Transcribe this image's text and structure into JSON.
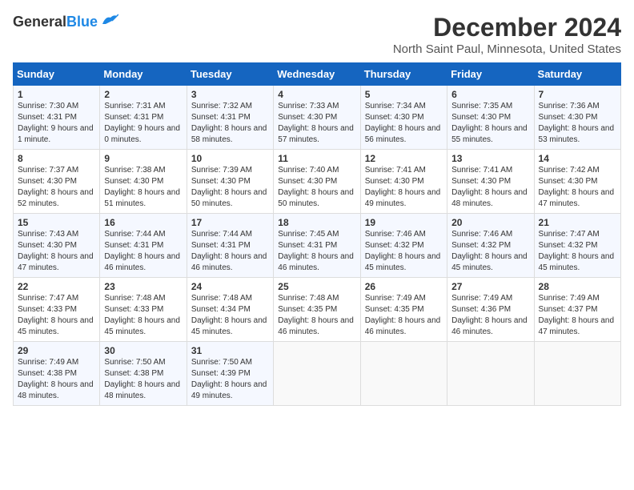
{
  "header": {
    "logo_line1": "General",
    "logo_line2": "Blue",
    "month": "December 2024",
    "location": "North Saint Paul, Minnesota, United States"
  },
  "days_of_week": [
    "Sunday",
    "Monday",
    "Tuesday",
    "Wednesday",
    "Thursday",
    "Friday",
    "Saturday"
  ],
  "weeks": [
    [
      {
        "day": "1",
        "sunrise": "7:30 AM",
        "sunset": "4:31 PM",
        "daylight": "9 hours and 1 minute."
      },
      {
        "day": "2",
        "sunrise": "7:31 AM",
        "sunset": "4:31 PM",
        "daylight": "9 hours and 0 minutes."
      },
      {
        "day": "3",
        "sunrise": "7:32 AM",
        "sunset": "4:31 PM",
        "daylight": "8 hours and 58 minutes."
      },
      {
        "day": "4",
        "sunrise": "7:33 AM",
        "sunset": "4:30 PM",
        "daylight": "8 hours and 57 minutes."
      },
      {
        "day": "5",
        "sunrise": "7:34 AM",
        "sunset": "4:30 PM",
        "daylight": "8 hours and 56 minutes."
      },
      {
        "day": "6",
        "sunrise": "7:35 AM",
        "sunset": "4:30 PM",
        "daylight": "8 hours and 55 minutes."
      },
      {
        "day": "7",
        "sunrise": "7:36 AM",
        "sunset": "4:30 PM",
        "daylight": "8 hours and 53 minutes."
      }
    ],
    [
      {
        "day": "8",
        "sunrise": "7:37 AM",
        "sunset": "4:30 PM",
        "daylight": "8 hours and 52 minutes."
      },
      {
        "day": "9",
        "sunrise": "7:38 AM",
        "sunset": "4:30 PM",
        "daylight": "8 hours and 51 minutes."
      },
      {
        "day": "10",
        "sunrise": "7:39 AM",
        "sunset": "4:30 PM",
        "daylight": "8 hours and 50 minutes."
      },
      {
        "day": "11",
        "sunrise": "7:40 AM",
        "sunset": "4:30 PM",
        "daylight": "8 hours and 50 minutes."
      },
      {
        "day": "12",
        "sunrise": "7:41 AM",
        "sunset": "4:30 PM",
        "daylight": "8 hours and 49 minutes."
      },
      {
        "day": "13",
        "sunrise": "7:41 AM",
        "sunset": "4:30 PM",
        "daylight": "8 hours and 48 minutes."
      },
      {
        "day": "14",
        "sunrise": "7:42 AM",
        "sunset": "4:30 PM",
        "daylight": "8 hours and 47 minutes."
      }
    ],
    [
      {
        "day": "15",
        "sunrise": "7:43 AM",
        "sunset": "4:30 PM",
        "daylight": "8 hours and 47 minutes."
      },
      {
        "day": "16",
        "sunrise": "7:44 AM",
        "sunset": "4:31 PM",
        "daylight": "8 hours and 46 minutes."
      },
      {
        "day": "17",
        "sunrise": "7:44 AM",
        "sunset": "4:31 PM",
        "daylight": "8 hours and 46 minutes."
      },
      {
        "day": "18",
        "sunrise": "7:45 AM",
        "sunset": "4:31 PM",
        "daylight": "8 hours and 46 minutes."
      },
      {
        "day": "19",
        "sunrise": "7:46 AM",
        "sunset": "4:32 PM",
        "daylight": "8 hours and 45 minutes."
      },
      {
        "day": "20",
        "sunrise": "7:46 AM",
        "sunset": "4:32 PM",
        "daylight": "8 hours and 45 minutes."
      },
      {
        "day": "21",
        "sunrise": "7:47 AM",
        "sunset": "4:32 PM",
        "daylight": "8 hours and 45 minutes."
      }
    ],
    [
      {
        "day": "22",
        "sunrise": "7:47 AM",
        "sunset": "4:33 PM",
        "daylight": "8 hours and 45 minutes."
      },
      {
        "day": "23",
        "sunrise": "7:48 AM",
        "sunset": "4:33 PM",
        "daylight": "8 hours and 45 minutes."
      },
      {
        "day": "24",
        "sunrise": "7:48 AM",
        "sunset": "4:34 PM",
        "daylight": "8 hours and 45 minutes."
      },
      {
        "day": "25",
        "sunrise": "7:48 AM",
        "sunset": "4:35 PM",
        "daylight": "8 hours and 46 minutes."
      },
      {
        "day": "26",
        "sunrise": "7:49 AM",
        "sunset": "4:35 PM",
        "daylight": "8 hours and 46 minutes."
      },
      {
        "day": "27",
        "sunrise": "7:49 AM",
        "sunset": "4:36 PM",
        "daylight": "8 hours and 46 minutes."
      },
      {
        "day": "28",
        "sunrise": "7:49 AM",
        "sunset": "4:37 PM",
        "daylight": "8 hours and 47 minutes."
      }
    ],
    [
      {
        "day": "29",
        "sunrise": "7:49 AM",
        "sunset": "4:38 PM",
        "daylight": "8 hours and 48 minutes."
      },
      {
        "day": "30",
        "sunrise": "7:50 AM",
        "sunset": "4:38 PM",
        "daylight": "8 hours and 48 minutes."
      },
      {
        "day": "31",
        "sunrise": "7:50 AM",
        "sunset": "4:39 PM",
        "daylight": "8 hours and 49 minutes."
      },
      null,
      null,
      null,
      null
    ]
  ]
}
